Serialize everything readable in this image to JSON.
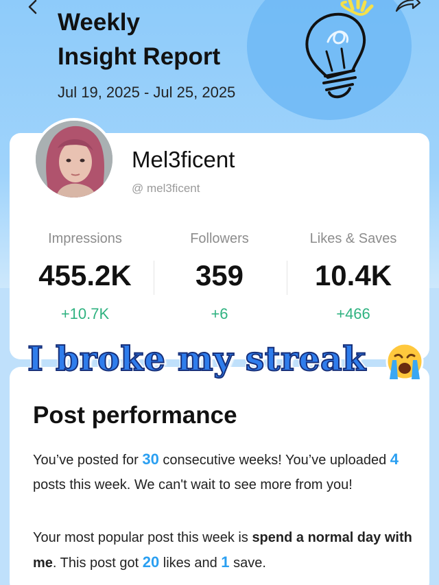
{
  "header": {
    "title": "Weekly\nInsight Report",
    "date_range": "Jul 19, 2025 - Jul 25, 2025"
  },
  "profile": {
    "name": "Mel3ficent",
    "handle": "@ mel3ficent"
  },
  "stats": [
    {
      "label": "Impressions",
      "value": "455.2K",
      "delta": "+10.7K"
    },
    {
      "label": "Followers",
      "value": "359",
      "delta": "+6"
    },
    {
      "label": "Likes & Saves",
      "value": "10.4K",
      "delta": "+466"
    }
  ],
  "sticker": {
    "text": "I broke my streak"
  },
  "performance": {
    "title": "Post performance",
    "p1": {
      "t1": "You’ve posted for ",
      "weeks": "30",
      "t2": " consecutive weeks! You’ve uploaded ",
      "posts": "4",
      "t3": " posts this week. We can't wait to see more from you!"
    },
    "p2": {
      "t1": "Your most popular post this week is ",
      "post_name": "spend a normal day with me",
      "t2": ". This post got ",
      "likes": "20",
      "t3": " likes and ",
      "saves": "1",
      "t4": " save."
    }
  },
  "colors": {
    "accent": "#2a9ff1",
    "positive": "#2fb280",
    "header_bg": "#8ecbfa"
  },
  "icons": {
    "back": "chevron-left-icon",
    "share": "share-icon",
    "illustration": "lightbulb-icon",
    "emoji": "crying-face-icon"
  }
}
